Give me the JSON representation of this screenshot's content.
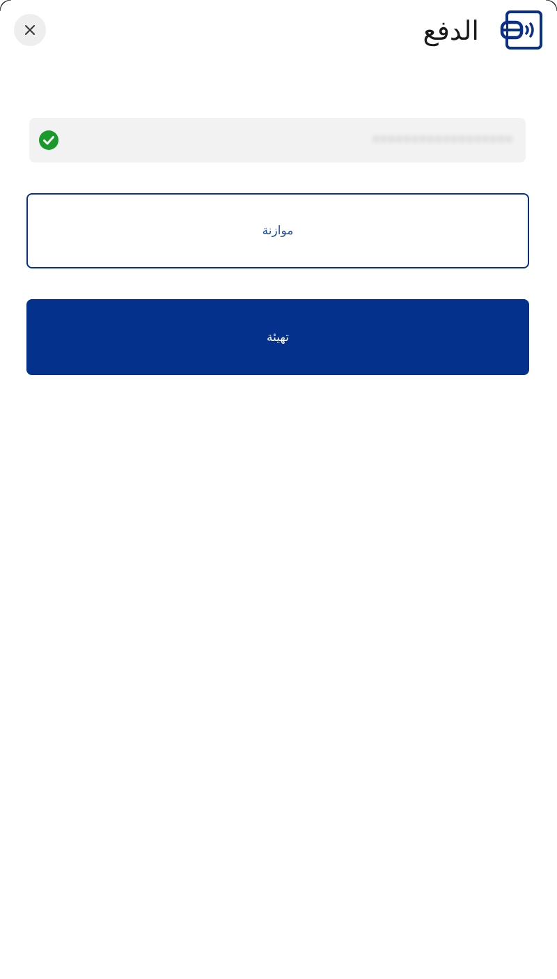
{
  "header": {
    "title": "الدفع",
    "close_icon": "close-icon",
    "brand_icon": "contactless-card-icon"
  },
  "card": {
    "masked_number": "••••••••••••••••••",
    "status_icon": "check-circle-icon",
    "status_color": "#1a9a2a"
  },
  "buttons": {
    "balance_label": "موازنة",
    "setup_label": "تهيئة"
  },
  "colors": {
    "primary": "#03318c",
    "outline_text": "#1f4e9c",
    "field_background": "#f2f2f2"
  }
}
